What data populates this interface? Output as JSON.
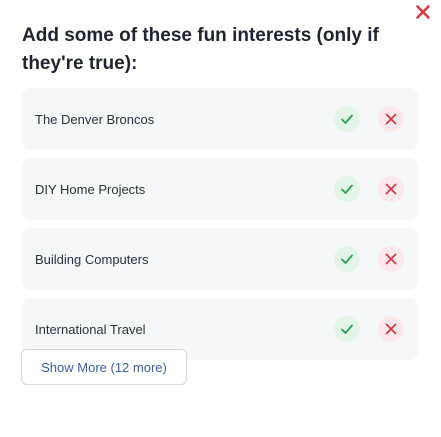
{
  "dialog": {
    "title": "Add some of these fun interests (only if they're true):",
    "close_icon": "close-icon"
  },
  "interests": [
    {
      "label": "The Denver Broncos"
    },
    {
      "label": "DIY Home Projects"
    },
    {
      "label": "Building Computers"
    },
    {
      "label": "International Travel"
    }
  ],
  "show_more": {
    "label": "Show More (12 more)"
  },
  "colors": {
    "accept": "#2e9e4f",
    "reject": "#d93a47",
    "link": "#3d5ba8",
    "close": "#d93a47"
  }
}
